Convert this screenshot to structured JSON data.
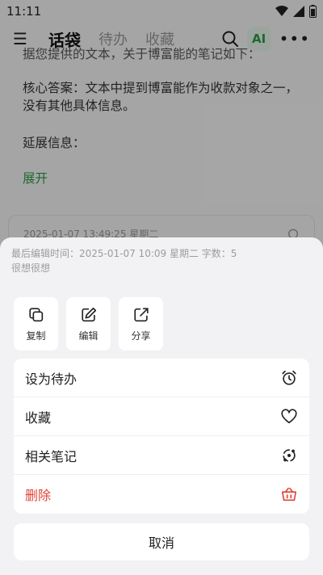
{
  "status_bar": {
    "time": "11:11"
  },
  "app_bar": {
    "tabs": [
      {
        "label": "话袋"
      },
      {
        "label": "待办"
      },
      {
        "label": "收藏"
      }
    ],
    "ai_label": "AI"
  },
  "background_note": {
    "cut_line": "据您提供的文本，关于博富能的笔记如下：",
    "answer": "核心答案：文本中提到博富能作为收款对象之一，没有其他具体信息。",
    "extended": "延展信息：",
    "expand": "展开",
    "next_card_date": "2025-01-07 13:49:25 星期二"
  },
  "sheet": {
    "meta_line": "最后编辑时间：2025-01-07 10:09 星期二 字数：5",
    "preview": "很想很想",
    "quick_actions": [
      {
        "label": "复制",
        "icon": "copy-icon"
      },
      {
        "label": "编辑",
        "icon": "edit-icon"
      },
      {
        "label": "分享",
        "icon": "share-icon"
      }
    ],
    "actions": [
      {
        "label": "设为待办",
        "icon": "alarm-clock-icon"
      },
      {
        "label": "收藏",
        "icon": "heart-icon"
      },
      {
        "label": "相关笔记",
        "icon": "related-notes-icon"
      },
      {
        "label": "删除",
        "icon": "trash-basket-icon"
      }
    ],
    "cancel": "取消"
  },
  "colors": {
    "accent_green": "#2e9b47",
    "danger_red": "#e0453a"
  }
}
